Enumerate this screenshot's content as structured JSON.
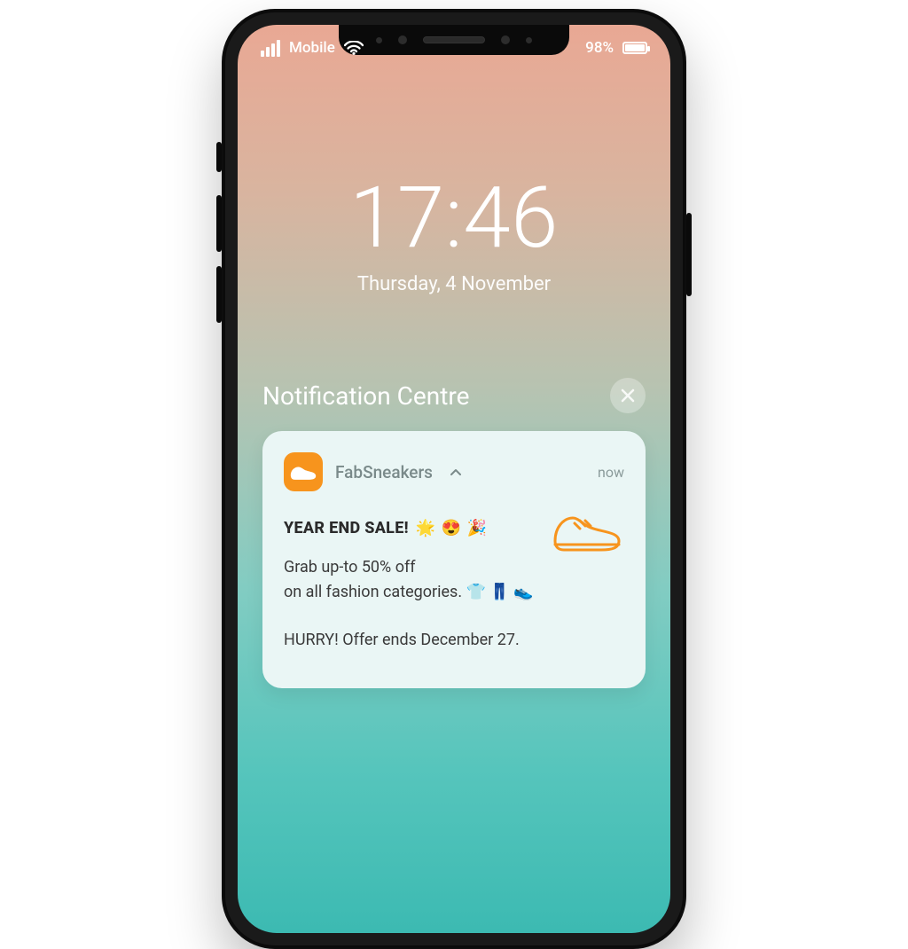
{
  "status": {
    "carrier": "Mobile",
    "battery_pct": "98%"
  },
  "lock": {
    "time": "17:46",
    "date": "Thursday, 4 November"
  },
  "nc": {
    "title": "Notification Centre"
  },
  "notif": {
    "app_name": "FabSneakers",
    "time": "now",
    "headline_text": "YEAR END SALE!",
    "headline_emojis": "🌟 😍 🎉",
    "body_line1": "Grab up-to 50% off",
    "body_line2": "on all fashion categories.",
    "body_emojis2": "👕 👖 👟",
    "body_line3": "HURRY! Offer ends December 27."
  },
  "colors": {
    "accent": "#f7941d"
  }
}
